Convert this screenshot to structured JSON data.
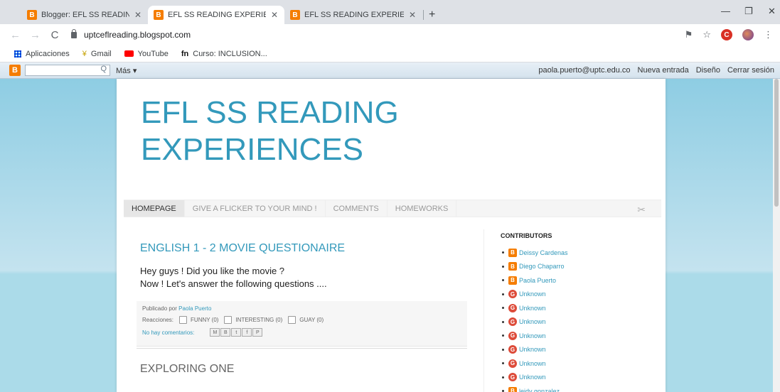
{
  "browser": {
    "tabs": [
      {
        "title": "Blogger: EFL SS READING EXPERI",
        "active": false
      },
      {
        "title": "EFL SS READING EXPERIENCES",
        "active": true
      },
      {
        "title": "EFL SS READING EXPERIENCES: E",
        "active": false
      }
    ],
    "tab_close": "✕",
    "new_tab": "+",
    "url": "uptceflreading.blogspot.com",
    "bookmarks": [
      "Aplicaciones",
      "Gmail",
      "YouTube",
      "Curso: INCLUSION..."
    ]
  },
  "blogger_bar": {
    "more": "Más ▾",
    "email": "paola.puerto@uptc.edu.co",
    "new_post": "Nueva entrada",
    "design": "Diseño",
    "sign_out": "Cerrar sesión"
  },
  "blog": {
    "title_line1": "EFL SS READING",
    "title_line2": "EXPERIENCES",
    "pages": [
      "HOMEPAGE",
      "GIVE A FLICKER TO YOUR MIND !",
      "COMMENTS",
      "HOMEWORKS"
    ]
  },
  "post": {
    "title": "ENGLISH 1 - 2 MOVIE QUESTIONAIRE",
    "line1": "Hey guys ! Did you like the movie ?",
    "line2": "Now ! Let's answer the following questions ....",
    "published_by": "Publicado por",
    "author": "Paola Puerto",
    "reactions_label": "Reacciones:",
    "reactions": [
      "FUNNY (0)",
      "INTERESTING (0)",
      "GUAY (0)"
    ],
    "comments": "No hay comentarios:"
  },
  "next_post": {
    "title": "EXPLORING ONE"
  },
  "sidebar": {
    "heading": "CONTRIBUTORS",
    "contributors": [
      {
        "name": "Deissy Cardenas",
        "icon": "blogger-icon"
      },
      {
        "name": "Diego Chaparro",
        "icon": "blogger-icon"
      },
      {
        "name": "Paola Puerto",
        "icon": "blogger-icon"
      },
      {
        "name": "Unknown",
        "icon": "google-plus-icon"
      },
      {
        "name": "Unknown",
        "icon": "google-plus-icon"
      },
      {
        "name": "Unknown",
        "icon": "google-plus-icon"
      },
      {
        "name": "Unknown",
        "icon": "google-plus-icon"
      },
      {
        "name": "Unknown",
        "icon": "google-plus-icon"
      },
      {
        "name": "Unknown",
        "icon": "google-plus-icon"
      },
      {
        "name": "Unknown",
        "icon": "google-plus-icon"
      },
      {
        "name": "leidy gonzalez",
        "icon": "blogger-icon"
      }
    ]
  },
  "colors": {
    "accent": "#3399bb",
    "blogger": "#f57d00",
    "page_bg": "#abdbe9"
  }
}
